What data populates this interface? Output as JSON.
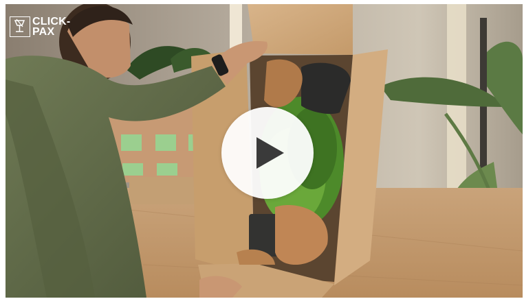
{
  "brand": {
    "line1": "CLICK-",
    "line2": "PAX"
  },
  "player": {
    "state": "paused",
    "play_icon": "play-icon"
  },
  "colors": {
    "play_button_bg": "#ffffff",
    "play_icon": "#3a3a3a",
    "logo": "#ffffff"
  }
}
